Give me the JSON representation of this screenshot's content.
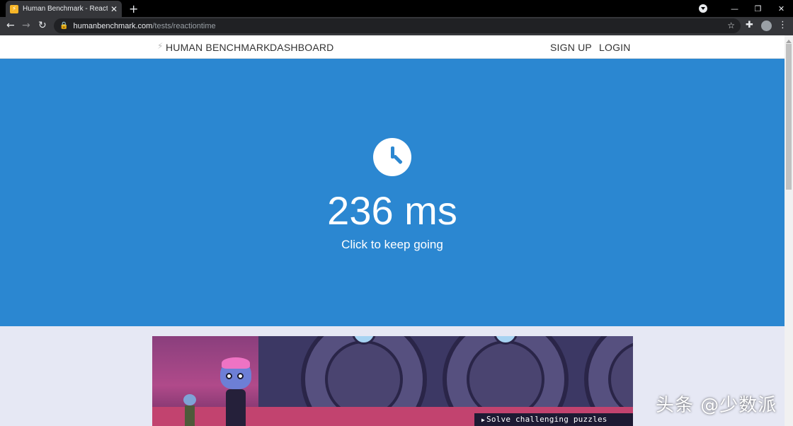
{
  "browser": {
    "tab_title": "Human Benchmark - Reaction",
    "url_host": "humanbenchmark.com",
    "url_path": "/tests/reactiontime"
  },
  "site_nav": {
    "brand": "HUMAN BENCHMARK",
    "dashboard": "DASHBOARD",
    "sign_up": "SIGN UP",
    "login": "LOGIN"
  },
  "test": {
    "result": "236 ms",
    "instruction": "Click to keep going",
    "icon": "clock-icon"
  },
  "ad": {
    "caption": "Solve challenging puzzles"
  },
  "watermark": "头条 @少数派",
  "colors": {
    "hero_blue": "#2b87d1",
    "page_bg": "#e6e8f4"
  }
}
